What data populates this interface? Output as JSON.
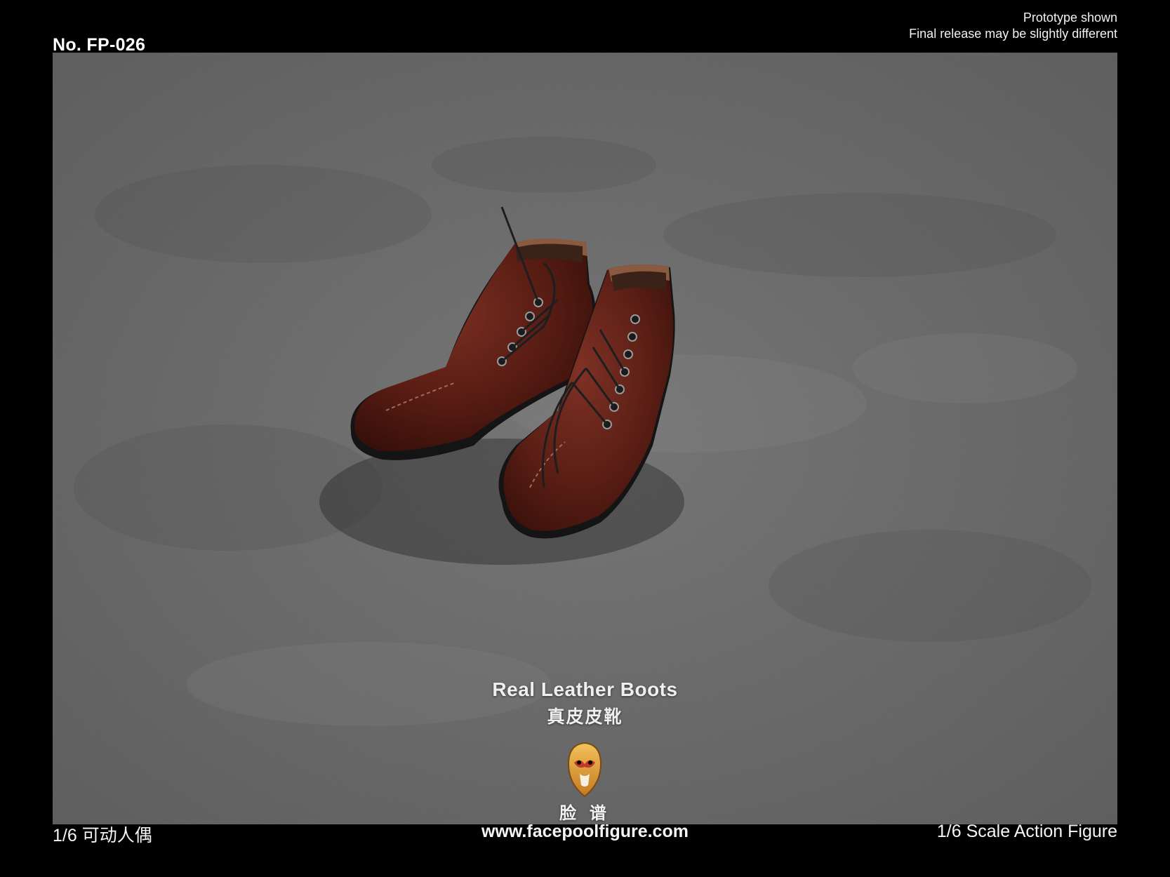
{
  "header": {
    "product_no": "No. FP-026",
    "notice_line1": "Prototype shown",
    "notice_line2": "Final release may be slightly different"
  },
  "photo": {
    "subject": "brown-leather-boots",
    "caption_en": "Real Leather Boots",
    "caption_cn": "真皮皮靴",
    "brand_cn": "脸 谱",
    "colors": {
      "background": "#6f6f6f",
      "leather": "#5a1f15",
      "sole": "#141414",
      "frame": "#000000"
    }
  },
  "footer": {
    "left": "1/6 可动人偶",
    "center": "www.facepoolfigure.com",
    "right": "1/6 Scale Action Figure"
  }
}
